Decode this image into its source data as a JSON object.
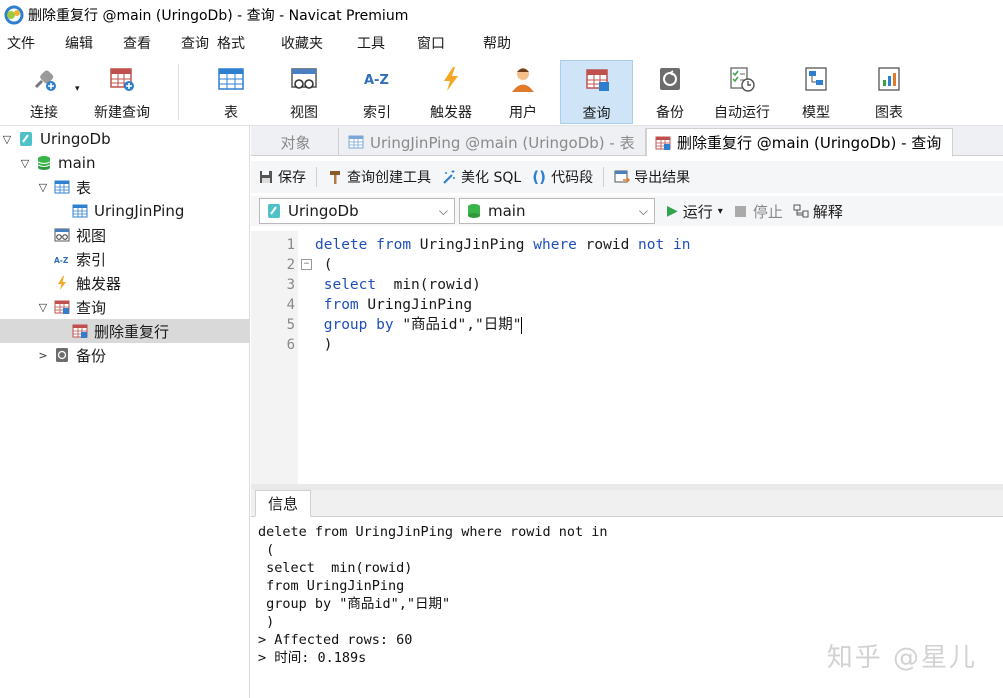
{
  "window": {
    "title": "删除重复行 @main (UringoDb) - 查询 - Navicat Premium"
  },
  "menu": [
    "文件",
    "编辑",
    "查看",
    "查询",
    "格式",
    "收藏夹",
    "工具",
    "窗口",
    "帮助"
  ],
  "toolbar": {
    "connect": "连接",
    "new_query": "新建查询",
    "table": "表",
    "view": "视图",
    "index": "索引",
    "trigger": "触发器",
    "user": "用户",
    "query": "查询",
    "backup": "备份",
    "auto_run": "自动运行",
    "model": "模型",
    "chart": "图表"
  },
  "tree": [
    {
      "label": "UringoDb",
      "icon": "database-connection-icon",
      "expanded": true
    },
    {
      "label": "main",
      "icon": "database-icon",
      "expanded": true
    },
    {
      "label": "表",
      "icon": "table-folder-icon",
      "expanded": true
    },
    {
      "label": "UringJinPing",
      "icon": "table-icon"
    },
    {
      "label": "视图",
      "icon": "view-icon"
    },
    {
      "label": "索引",
      "icon": "index-icon"
    },
    {
      "label": "触发器",
      "icon": "trigger-icon"
    },
    {
      "label": "查询",
      "icon": "query-folder-icon",
      "expanded": true
    },
    {
      "label": "删除重复行",
      "icon": "query-icon",
      "selected": true
    },
    {
      "label": "备份",
      "icon": "backup-icon",
      "expanded": false
    }
  ],
  "tabs": [
    {
      "label": "对象",
      "active": false
    },
    {
      "label": "UringJinPing @main (UringoDb) - 表",
      "active": false
    },
    {
      "label": "删除重复行 @main (UringoDb) - 查询",
      "active": true
    }
  ],
  "query_toolbar": {
    "save": "保存",
    "query_builder": "查询创建工具",
    "beautify_sql": "美化 SQL",
    "code_snippet": "代码段",
    "export_results": "导出结果"
  },
  "selectors": {
    "connection": "UringoDb",
    "database": "main",
    "run": "运行",
    "stop": "停止",
    "explain": "解释"
  },
  "editor": {
    "lines": [
      {
        "n": "1",
        "tokens": [
          [
            "kw",
            "delete"
          ],
          [
            "id",
            " "
          ],
          [
            "kw",
            "from"
          ],
          [
            "id",
            " UringJinPing "
          ],
          [
            "kw",
            "where"
          ],
          [
            "id",
            " rowid "
          ],
          [
            "kw",
            "not"
          ],
          [
            "id",
            " "
          ],
          [
            "kw",
            "in"
          ]
        ]
      },
      {
        "n": "2",
        "tokens": [
          [
            "id",
            " ("
          ]
        ]
      },
      {
        "n": "3",
        "tokens": [
          [
            "id",
            " "
          ],
          [
            "kw",
            "select"
          ],
          [
            "id",
            "  min(rowid)"
          ]
        ]
      },
      {
        "n": "4",
        "tokens": [
          [
            "id",
            " "
          ],
          [
            "kw",
            "from"
          ],
          [
            "id",
            " UringJinPing"
          ]
        ]
      },
      {
        "n": "5",
        "tokens": [
          [
            "id",
            " "
          ],
          [
            "kw",
            "group"
          ],
          [
            "id",
            " "
          ],
          [
            "kw",
            "by"
          ],
          [
            "id",
            " \"商品id\",\"日期\""
          ]
        ]
      },
      {
        "n": "6",
        "tokens": [
          [
            "id",
            " )"
          ]
        ]
      }
    ]
  },
  "info": {
    "tab": "信息",
    "lines": [
      "delete from UringJinPing where rowid not in",
      " (",
      " select  min(rowid)",
      " from UringJinPing",
      " group by \"商品id\",\"日期\"",
      " )",
      "> Affected rows: 60",
      "> 时间: 0.189s"
    ]
  },
  "watermark": "知乎 @星儿"
}
